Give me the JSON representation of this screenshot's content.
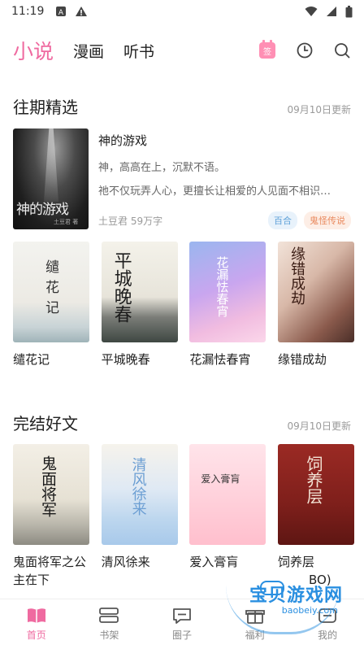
{
  "status": {
    "time": "11:19"
  },
  "top_tabs": [
    "小说",
    "漫画",
    "听书"
  ],
  "signin_label": "签",
  "past_picks": {
    "title": "往期精选",
    "date": "09月10日更新",
    "featured": {
      "title": "神的游戏",
      "desc_line1": "神，高高在上，沉默不语。",
      "desc_line2": "祂不仅玩弄人心，更擅长让相爱的人见面不相识…",
      "author_words": "土豆君 59万字",
      "tags": [
        "百合",
        "鬼怪传说"
      ],
      "cover_title": "神的游戏",
      "cover_sub": "土豆君 著"
    },
    "books": [
      {
        "title": "缱花记",
        "cover_text": "缱花记"
      },
      {
        "title": "平城晚春",
        "cover_text": "平城晚春"
      },
      {
        "title": "花漏怯春宵",
        "cover_text": "花漏怯春宵"
      },
      {
        "title": "缘错成劫",
        "cover_text": "缘错成劫"
      }
    ]
  },
  "finished": {
    "title": "完结好文",
    "date": "09月10日更新",
    "books": [
      {
        "title": "鬼面将军之公主在下",
        "cover_text": "鬼面将军"
      },
      {
        "title": "清风徐来",
        "cover_text": "清风徐来"
      },
      {
        "title": "爱入膏肓",
        "cover_text": "爱入膏肓"
      },
      {
        "title": "饲养层",
        "cover_text": "饲养层",
        "title_suffix": "BO)"
      }
    ]
  },
  "bottom_nav": [
    "首页",
    "书架",
    "圈子",
    "福利",
    "我的"
  ],
  "watermark": {
    "text": "宝贝游戏网",
    "url": "baobeiy.com"
  },
  "colors": {
    "accent": "#ef6aa0",
    "tag_blue": "#5fa1d8",
    "tag_orange": "#e98a5f"
  }
}
